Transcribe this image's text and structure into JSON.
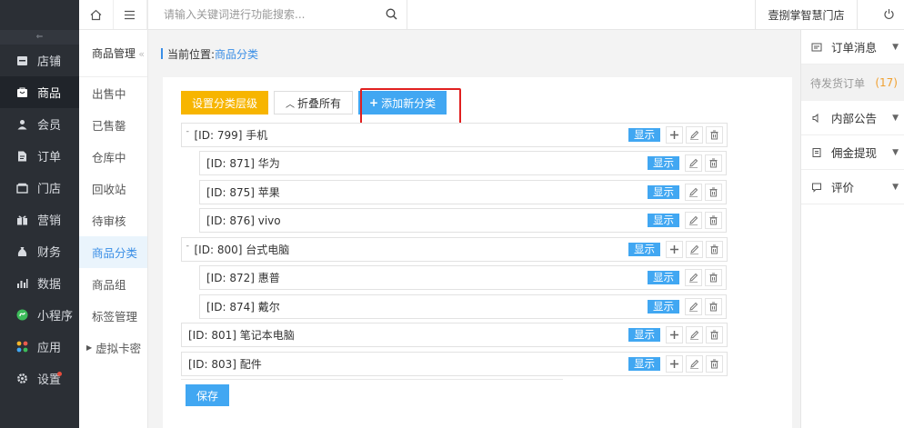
{
  "sidebar": {
    "toggle_label": "<=",
    "items": [
      {
        "label": "店铺",
        "icon": "store-icon"
      },
      {
        "label": "商品",
        "icon": "goods-icon"
      },
      {
        "label": "会员",
        "icon": "member-icon"
      },
      {
        "label": "订单",
        "icon": "order-icon"
      },
      {
        "label": "门店",
        "icon": "shop-icon"
      },
      {
        "label": "营销",
        "icon": "gift-icon"
      },
      {
        "label": "财务",
        "icon": "money-bag-icon"
      },
      {
        "label": "数据",
        "icon": "chart-icon"
      },
      {
        "label": "小程序",
        "icon": "miniapp-icon"
      },
      {
        "label": "应用",
        "icon": "apps-icon"
      },
      {
        "label": "设置",
        "icon": "gear-icon"
      }
    ],
    "active_index": 1
  },
  "subnav": {
    "title": "商品管理",
    "collapse_glyph": "«",
    "items": [
      "出售中",
      "已售罄",
      "仓库中",
      "回收站",
      "待审核",
      "商品分类",
      "商品组",
      "标签管理",
      "虚拟卡密"
    ],
    "active_index": 5
  },
  "topbar": {
    "search_placeholder": "请输入关键词进行功能搜索...",
    "store_name": "壹捌掌智慧门店"
  },
  "breadcrumb": {
    "prefix": "当前位置:",
    "current": "商品分类"
  },
  "toolbar": {
    "set_level": "设置分类层级",
    "fold_all": "折叠所有",
    "add_new": "添加新分类"
  },
  "categories": [
    {
      "label": "[ID: 799] 手机",
      "level": 0,
      "foldable": true
    },
    {
      "label": "[ID: 871] 华为",
      "level": 1
    },
    {
      "label": "[ID: 875] 苹果",
      "level": 1
    },
    {
      "label": "[ID: 876] vivo",
      "level": 1
    },
    {
      "label": "[ID: 800] 台式电脑",
      "level": 0,
      "foldable": true
    },
    {
      "label": "[ID: 872] 惠普",
      "level": 1
    },
    {
      "label": "[ID: 874] 戴尔",
      "level": 1
    },
    {
      "label": "[ID: 801] 笔记本电脑",
      "level": 0
    },
    {
      "label": "[ID: 803] 配件",
      "level": 0
    }
  ],
  "row_tag": "显示",
  "save_label": "保存",
  "right_panel": {
    "order_msg": "订单消息",
    "pending_label": "待发货订单",
    "pending_count": "(17)",
    "notice": "内部公告",
    "commission": "佣金提现",
    "review": "评价"
  },
  "colors": {
    "accent": "#41a7f2",
    "warning": "#f7b500",
    "highlight": "#e02020",
    "sidebar": "#2b2f35"
  }
}
